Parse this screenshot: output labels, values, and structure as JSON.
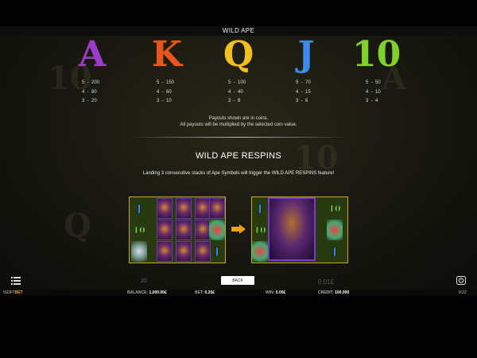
{
  "header": {
    "title": "WILD APE"
  },
  "paytable": [
    {
      "symbol": "A",
      "color": "#9b3ad0",
      "lines": [
        "5  -  200",
        "4  -  80",
        "3  -  20"
      ]
    },
    {
      "symbol": "K",
      "color": "#e8561e",
      "lines": [
        "5  -  150",
        "4  -  60",
        "3  -  10"
      ]
    },
    {
      "symbol": "Q",
      "color": "#f0c020",
      "lines": [
        "5  -  100",
        "4  -  40",
        "3  -  8"
      ]
    },
    {
      "symbol": "J",
      "color": "#3a8cf0",
      "lines": [
        "5  -  70",
        "4  -  15",
        "3  -  6"
      ]
    },
    {
      "symbol": "10",
      "color": "#7cd12a",
      "lines": [
        "5  -  50",
        "4  -  10",
        "3  -  4"
      ]
    }
  ],
  "notes": {
    "line1": "Payouts shown are in coins.",
    "line2": "All payouts will be multiplied by the selected coin value."
  },
  "respins": {
    "title": "WILD APE RESPINS",
    "description": "Landing 3 consecutive stacks of Ape Symbols will trigger the WILD APE RESPINS feature!"
  },
  "example_reels": {
    "before": {
      "col1": [
        "J",
        "10",
        "vase"
      ],
      "col5": [
        "ape-head",
        "bird",
        "J"
      ]
    },
    "after": {
      "col1": [
        "J",
        "10",
        "bird"
      ],
      "col5": [
        "10",
        "bird",
        "J"
      ]
    }
  },
  "controls": {
    "back_label": "BACK"
  },
  "ghost": {
    "bet": "20",
    "win": "0.01£"
  },
  "bottom_bar": {
    "logo_left": "ISOFT",
    "logo_right": "BET",
    "balance_label": "BALANCE:",
    "balance_value": "1,000.00£",
    "bet_label": "BET:",
    "bet_value": "0.20£",
    "win_label": "WIN:",
    "win_value": "0.00£",
    "credit_label": "CREDIT:",
    "credit_value": "100,000",
    "time": "9:22"
  },
  "icons": [
    "menu-icon",
    "history-icon",
    "right-arrow-icon"
  ]
}
